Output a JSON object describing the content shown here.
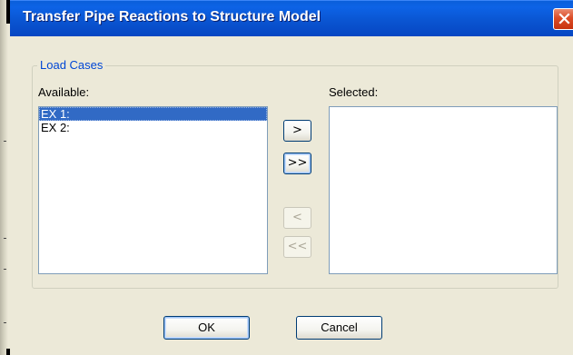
{
  "window": {
    "title": "Transfer Pipe Reactions to Structure Model",
    "close_label": "Close"
  },
  "load_cases": {
    "group_label": "Load Cases",
    "available_label": "Available:",
    "selected_label": "Selected:",
    "available_items": [
      "EX 1:",
      "EX 2:"
    ],
    "selected_items": [],
    "selected_index": 0
  },
  "buttons": {
    "add": ">",
    "add_all": ">>",
    "remove": "<",
    "remove_all": "<<",
    "ok": "OK",
    "cancel": "Cancel"
  },
  "colors": {
    "titlebar": "#0a55d2",
    "group_label": "#0046d5",
    "selection": "#316ac5",
    "close_button": "#dc4c26"
  }
}
